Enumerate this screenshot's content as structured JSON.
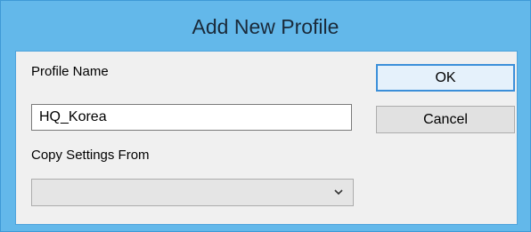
{
  "dialog": {
    "title": "Add New Profile"
  },
  "form": {
    "profile_name_label": "Profile Name",
    "profile_name_value": "HQ_Korea",
    "copy_settings_label": "Copy Settings From",
    "copy_settings_value": ""
  },
  "buttons": {
    "ok_label": "OK",
    "cancel_label": "Cancel"
  },
  "colors": {
    "titlebar": "#63b8ea",
    "client_bg": "#f0f0f0",
    "default_button_border": "#3c8fd9"
  },
  "icons": {
    "combo_arrow": "chevron-down-icon"
  }
}
